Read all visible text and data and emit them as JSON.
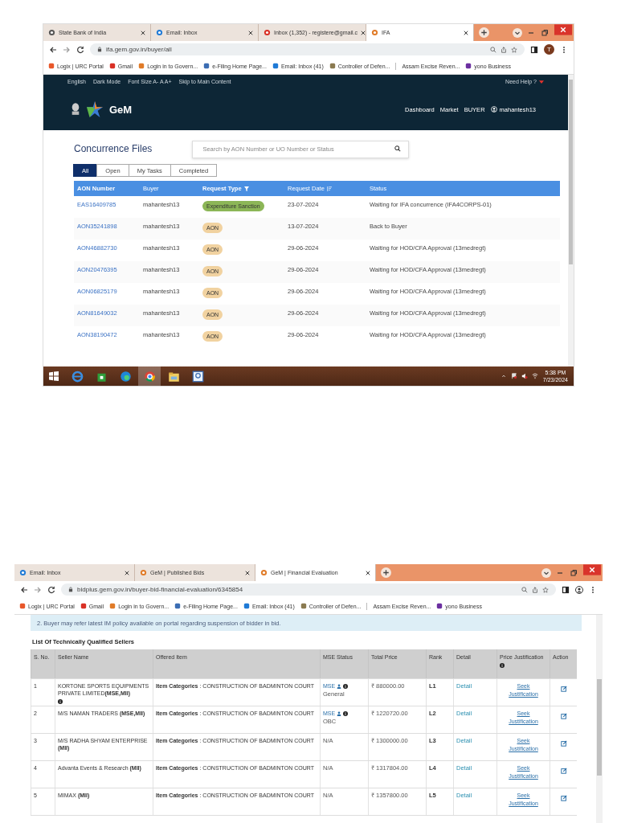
{
  "screenshots": [
    {
      "kind": "concurrence",
      "browser": {
        "tabs": [
          {
            "label": "State Bank of India",
            "kind": "globe",
            "selected": false
          },
          {
            "label": "Email: Inbox",
            "kind": "edge",
            "selected": false
          },
          {
            "label": "Inbox (1,352) - registere@gmail.c",
            "kind": "gmail",
            "selected": false
          },
          {
            "label": "IFA",
            "kind": "gem",
            "selected": true
          }
        ],
        "address": "ifa.gem.gov.in/buyer/all",
        "avatar": "T",
        "bookmarks": [
          {
            "label": "Logix | URC Portal",
            "kind": "logix"
          },
          {
            "label": "Gmail",
            "kind": "gmail"
          },
          {
            "label": "Login in to Govern...",
            "kind": "gem"
          },
          {
            "label": "e-Filing Home Page...",
            "kind": "efiling"
          },
          {
            "label": "Email: Inbox (41)",
            "kind": "edge"
          },
          {
            "label": "Controller of Defen...",
            "kind": "emblem"
          },
          {
            "label": "Assam Excise Reven...",
            "kind": "divider"
          },
          {
            "label": "yono Business",
            "kind": "yono"
          }
        ]
      },
      "page": {
        "utility_links": [
          "English",
          "Dark Mode",
          "Font Size  A-  A  A+",
          "Skip to Main Content"
        ],
        "help": "Need Help ?",
        "logo": "GeM",
        "nav": [
          "Dashboard",
          "Market",
          "BUYER"
        ],
        "user": "mahantesh13",
        "title": "Concurrence Files",
        "search": {
          "placeholder": "Search by AON Number or UO Number or Status"
        },
        "filters": [
          {
            "label": "All",
            "selected": true
          },
          {
            "label": "Open",
            "selected": false
          },
          {
            "label": "My Tasks",
            "selected": false
          },
          {
            "label": "Completed",
            "selected": false
          }
        ],
        "columns": [
          {
            "label": "AON Number",
            "bold": true,
            "kind": "plain"
          },
          {
            "label": "Buyer",
            "bold": false,
            "kind": "plain"
          },
          {
            "label": "Request Type",
            "bold": true,
            "kind": "filter"
          },
          {
            "label": "Request Date",
            "bold": false,
            "kind": "sort"
          },
          {
            "label": "Status",
            "bold": false,
            "kind": "plain"
          }
        ],
        "rows": [
          {
            "aon": "EAS16409785",
            "buyer": "mahantesh13",
            "type": {
              "label": "Expenditure Sanction",
              "kind": "expenditure"
            },
            "date": "23-07-2024",
            "status": "Waiting for IFA concurrence (IFA4CORPS-01)"
          },
          {
            "aon": "AON35241898",
            "buyer": "mahantesh13",
            "type": {
              "label": "AON",
              "kind": "aon"
            },
            "date": "13-07-2024",
            "status": "Back to Buyer"
          },
          {
            "aon": "AON46882730",
            "buyer": "mahantesh13",
            "type": {
              "label": "AON",
              "kind": "aon"
            },
            "date": "29-06-2024",
            "status": "Waiting for HOD/CFA Approval (13medregt)"
          },
          {
            "aon": "AON20476395",
            "buyer": "mahantesh13",
            "type": {
              "label": "AON",
              "kind": "aon"
            },
            "date": "29-06-2024",
            "status": "Waiting for HOD/CFA Approval (13medregt)"
          },
          {
            "aon": "AON06825179",
            "buyer": "mahantesh13",
            "type": {
              "label": "AON",
              "kind": "aon"
            },
            "date": "29-06-2024",
            "status": "Waiting for HOD/CFA Approval (13medregt)"
          },
          {
            "aon": "AON81649032",
            "buyer": "mahantesh13",
            "type": {
              "label": "AON",
              "kind": "aon"
            },
            "date": "29-06-2024",
            "status": "Waiting for HOD/CFA Approval (13medregt)"
          },
          {
            "aon": "AON38190472",
            "buyer": "mahantesh13",
            "type": {
              "label": "AON",
              "kind": "aon"
            },
            "date": "29-06-2024",
            "status": "Waiting for HOD/CFA Approval (13medregt)"
          }
        ]
      },
      "taskbar": {
        "apps": [
          {
            "kind": "ie",
            "selected": false
          },
          {
            "kind": "store",
            "selected": false
          },
          {
            "kind": "edge",
            "selected": false
          },
          {
            "kind": "chrome",
            "selected": true
          },
          {
            "kind": "explorer",
            "selected": false
          },
          {
            "kind": "nic",
            "selected": false
          }
        ],
        "time": "5:38 PM",
        "date": "7/23/2024"
      }
    },
    {
      "kind": "financial",
      "browser": {
        "tabs": [
          {
            "label": "Email: Inbox",
            "kind": "edge",
            "selected": false
          },
          {
            "label": "GeM | Published Bids",
            "kind": "gem",
            "selected": false
          },
          {
            "label": "GeM | Financial Evaluation",
            "kind": "gem",
            "selected": true
          }
        ],
        "address": "bidplus.gem.gov.in/buyer-bid-financial-evaluation/6345854",
        "bookmarks": [
          {
            "label": "Logix | URC Portal",
            "kind": "logix"
          },
          {
            "label": "Gmail",
            "kind": "gmail"
          },
          {
            "label": "Login in to Govern...",
            "kind": "gem"
          },
          {
            "label": "e-Filing Home Page...",
            "kind": "efiling"
          },
          {
            "label": "Email: Inbox (41)",
            "kind": "edge"
          },
          {
            "label": "Controller of Defen...",
            "kind": "emblem"
          },
          {
            "label": "Assam Excise Reven...",
            "kind": "divider"
          },
          {
            "label": "yono Business",
            "kind": "yono"
          }
        ]
      },
      "page": {
        "notice": "2. Buyer may refer latest IM policy available on portal regarding suspension of bidder in bid.",
        "title": "List Of Technically Qualified Sellers",
        "columns": [
          "S. No.",
          "Seller Name",
          "Offered Item",
          "MSE Status",
          "Total Price",
          "Rank",
          "Detail",
          "Price Justification",
          "Action"
        ],
        "rows": [
          {
            "sno": "1",
            "seller": "KORTONE SPORTS EQUIPMENTS PRIVATE LIMITED**(MSE,MII)**",
            "seller_info": true,
            "item": "**Item Categories** : CONSTRUCTION OF BADMINTON COURT",
            "mse": {
              "kind": "mse",
              "label": "MSE",
              "category": "General"
            },
            "price": "₹  880000.00",
            "rank": "L1",
            "detail": "Detail",
            "justification": "Seek Justification"
          },
          {
            "sno": "2",
            "seller": "M/S NAMAN TRADERS **(MSE,MII)**",
            "seller_info": false,
            "item": "**Item Categories** : CONSTRUCTION OF BADMINTON COURT",
            "mse": {
              "kind": "mse",
              "label": "MSE",
              "category": "OBC"
            },
            "price": "₹  1220720.00",
            "rank": "L2",
            "detail": "Detail",
            "justification": "Seek Justification"
          },
          {
            "sno": "3",
            "seller": "M/S RADHA SHYAM ENTERPRISE **(MII)**",
            "seller_info": false,
            "item": "**Item Categories** : CONSTRUCTION OF BADMINTON COURT",
            "mse": {
              "kind": "na",
              "label": "N/A"
            },
            "price": "₹  1300000.00",
            "rank": "L3",
            "detail": "Detail",
            "justification": "Seek Justification"
          },
          {
            "sno": "4",
            "seller": "Advanta Events & Research **(MII)**",
            "seller_info": false,
            "item": "**Item Categories** : CONSTRUCTION OF BADMINTON COURT",
            "mse": {
              "kind": "na",
              "label": "N/A"
            },
            "price": "₹  1317804.00",
            "rank": "L4",
            "detail": "Detail",
            "justification": "Seek Justification"
          },
          {
            "sno": "5",
            "seller": "MIMAX **(MII)**",
            "seller_info": false,
            "item": "**Item Categories** : CONSTRUCTION OF BADMINTON COURT",
            "mse": {
              "kind": "na",
              "label": "N/A"
            },
            "price": "₹  1357800.00",
            "rank": "L5",
            "detail": "Detail",
            "justification": "Seek Justification"
          }
        ]
      }
    }
  ]
}
